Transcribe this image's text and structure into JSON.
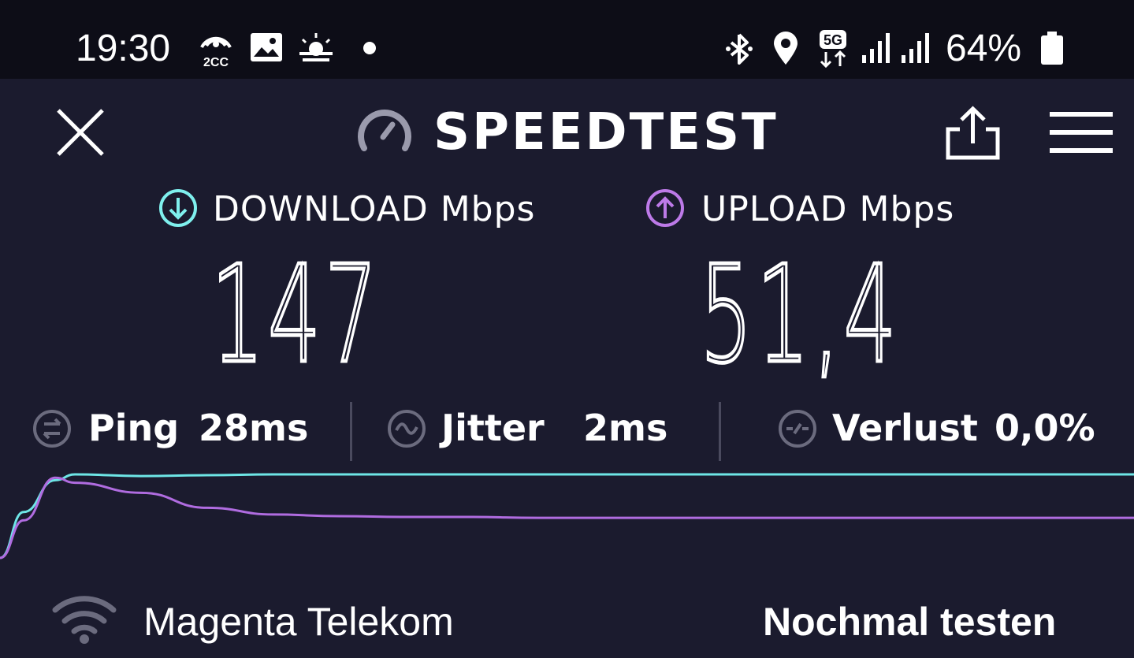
{
  "status_bar": {
    "time": "19:30",
    "battery": "64%",
    "notification_icons": [
      "2cc-hotspot-icon",
      "image-icon",
      "sunrise-weather-icon",
      "dot-icon"
    ],
    "system_icons": [
      "bluetooth-icon",
      "location-icon",
      "5g-icon",
      "signal-icon",
      "signal-icon",
      "battery-icon"
    ]
  },
  "header": {
    "title": "SPEEDTEST",
    "close_icon": "close-icon",
    "logo_icon": "speedometer-icon",
    "share_icon": "share-icon",
    "menu_icon": "hamburger-menu-icon"
  },
  "metrics": {
    "download": {
      "label": "DOWNLOAD Mbps",
      "value": "147",
      "color": "#7ff0ee"
    },
    "upload": {
      "label": "UPLOAD Mbps",
      "value": "51,4",
      "color": "#bd7ae8"
    }
  },
  "stats": {
    "ping": {
      "label": "Ping",
      "value": "28ms"
    },
    "jitter": {
      "label": "Jitter",
      "value": "2ms"
    },
    "loss": {
      "label": "Verlust",
      "value": "0,0%"
    }
  },
  "chart_data": {
    "type": "line",
    "series": [
      {
        "color": "#6ee6e6",
        "values": [
          0.0,
          0.55,
          0.93,
          1.0,
          0.98,
          0.99,
          1.0,
          1.0,
          1.0,
          1.0,
          1.0,
          1.0,
          1.0,
          1.0,
          1.0,
          1.0,
          1.0,
          1.0,
          1.0,
          1.0
        ]
      },
      {
        "color": "#b06ce0",
        "values": [
          0.0,
          0.45,
          0.96,
          0.9,
          0.78,
          0.6,
          0.52,
          0.5,
          0.49,
          0.49,
          0.48,
          0.48,
          0.48,
          0.48,
          0.48,
          0.48,
          0.48,
          0.48,
          0.48,
          0.48
        ]
      }
    ]
  },
  "footer": {
    "provider": "Magenta Telekom",
    "provider_icon": "wifi-icon",
    "retest_label": "Nochmal testen"
  }
}
